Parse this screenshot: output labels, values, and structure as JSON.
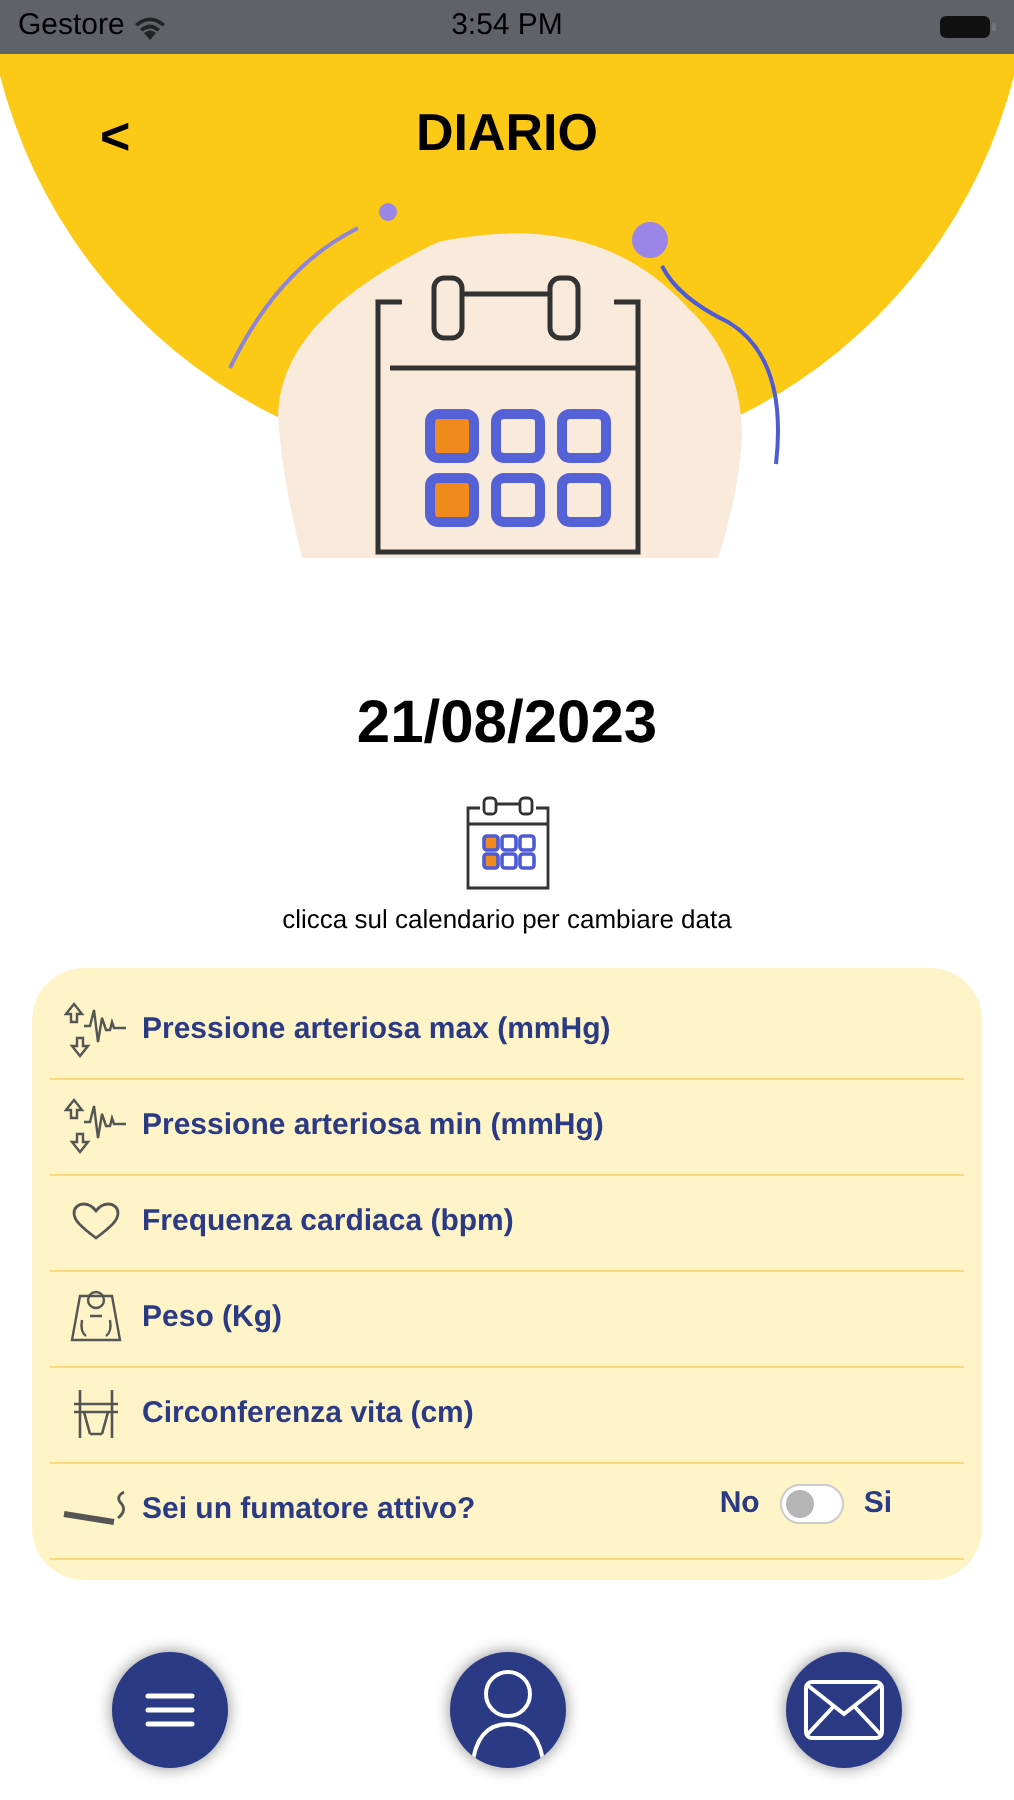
{
  "status_bar": {
    "carrier": "Gestore",
    "time": "3:54 PM"
  },
  "header": {
    "back": "<",
    "title": "DIARIO"
  },
  "date": {
    "value": "21/08/2023",
    "hint": "clicca sul calendario per cambiare data"
  },
  "rows": [
    {
      "kind": "measure",
      "label": "Pressione arteriosa max (mmHg)"
    },
    {
      "kind": "measure",
      "label": "Pressione arteriosa min (mmHg)"
    },
    {
      "kind": "measure",
      "label": "Frequenza cardiaca (bpm)"
    },
    {
      "kind": "measure",
      "label": "Peso (Kg)"
    },
    {
      "kind": "measure",
      "label": "Circonferenza vita (cm)"
    },
    {
      "kind": "toggle",
      "label": "Sei un fumatore attivo?",
      "off_label": "No",
      "on_label": "Si",
      "on": false
    }
  ]
}
